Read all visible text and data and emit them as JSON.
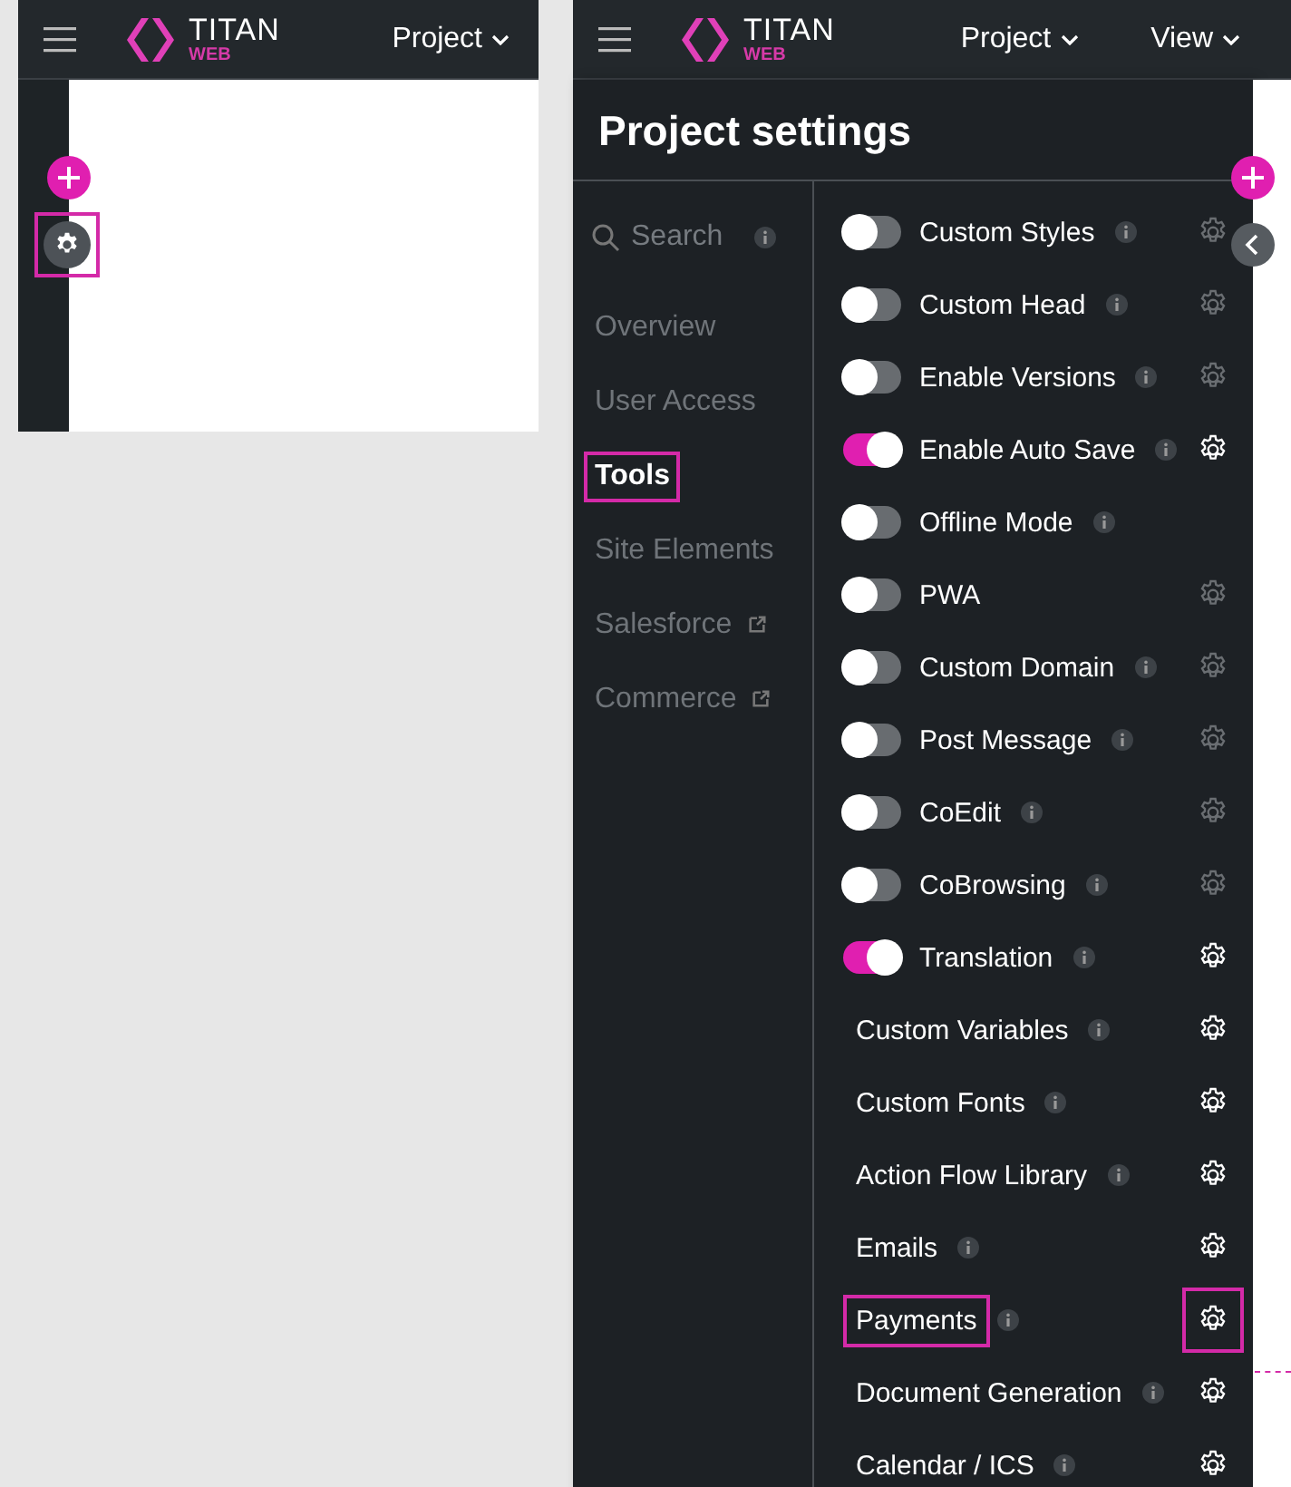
{
  "left_window": {
    "header": {
      "logo_title": "TITAN",
      "logo_subtitle": "WEB",
      "menus": [
        {
          "label": "Project"
        }
      ]
    },
    "gear_highlighted": true
  },
  "right_window": {
    "header": {
      "logo_title": "TITAN",
      "logo_subtitle": "WEB",
      "menus": [
        {
          "label": "Project"
        },
        {
          "label": "View"
        }
      ]
    },
    "title": "Project settings",
    "search": {
      "placeholder": "Search"
    },
    "nav": [
      {
        "label": "Overview",
        "selected": false,
        "highlighted": false,
        "external": false
      },
      {
        "label": "User Access",
        "selected": false,
        "highlighted": false,
        "external": false
      },
      {
        "label": "Tools",
        "selected": true,
        "highlighted": true,
        "external": false
      },
      {
        "label": "Site Elements",
        "selected": false,
        "highlighted": false,
        "external": false
      },
      {
        "label": "Salesforce",
        "selected": false,
        "highlighted": false,
        "external": true
      },
      {
        "label": "Commerce",
        "selected": false,
        "highlighted": false,
        "external": true
      }
    ],
    "tools": [
      {
        "kind": "toggle",
        "label": "Custom Styles",
        "on": false,
        "info": true,
        "gear": true
      },
      {
        "kind": "toggle",
        "label": "Custom Head",
        "on": false,
        "info": true,
        "gear": true
      },
      {
        "kind": "toggle",
        "label": "Enable Versions",
        "on": false,
        "info": true,
        "gear": true
      },
      {
        "kind": "toggle",
        "label": "Enable Auto Save",
        "on": true,
        "info": true,
        "gear": true
      },
      {
        "kind": "toggle",
        "label": "Offline Mode",
        "on": false,
        "info": true,
        "gear": false
      },
      {
        "kind": "toggle",
        "label": "PWA",
        "on": false,
        "info": false,
        "gear": true
      },
      {
        "kind": "toggle",
        "label": "Custom Domain",
        "on": false,
        "info": true,
        "gear": true
      },
      {
        "kind": "toggle",
        "label": "Post Message",
        "on": false,
        "info": true,
        "gear": true
      },
      {
        "kind": "toggle",
        "label": "CoEdit",
        "on": false,
        "info": true,
        "gear": true
      },
      {
        "kind": "toggle",
        "label": "CoBrowsing",
        "on": false,
        "info": true,
        "gear": true
      },
      {
        "kind": "toggle",
        "label": "Translation",
        "on": true,
        "info": true,
        "gear": true
      },
      {
        "kind": "plain",
        "label": "Custom Variables",
        "info": true,
        "gear": true
      },
      {
        "kind": "plain",
        "label": "Custom Fonts",
        "info": true,
        "gear": true
      },
      {
        "kind": "plain",
        "label": "Action Flow Library",
        "info": true,
        "gear": true
      },
      {
        "kind": "plain",
        "label": "Emails",
        "info": true,
        "gear": true
      },
      {
        "kind": "plain",
        "label": "Payments",
        "info": true,
        "gear": true,
        "highlighted": true
      },
      {
        "kind": "plain",
        "label": "Document Generation",
        "info": true,
        "gear": true
      },
      {
        "kind": "plain",
        "label": "Calendar / ICS",
        "info": true,
        "gear": true
      }
    ]
  }
}
